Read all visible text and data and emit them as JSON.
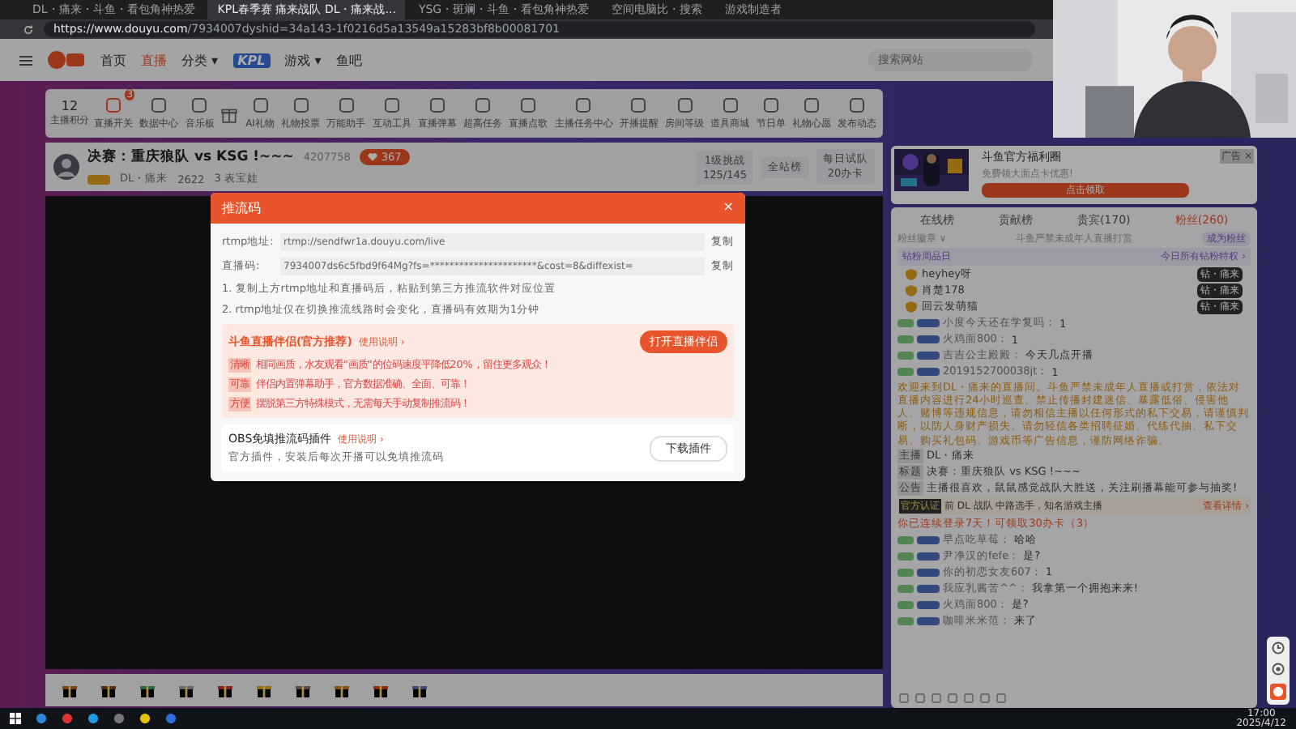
{
  "browser": {
    "tabs": [
      {
        "label": "DL・痛来・斗鱼・看包角神热爱",
        "selected": false
      },
      {
        "label": "KPL春季赛 痛来战队 DL・痛来战...",
        "selected": true
      },
      {
        "label": "YSG・斑斓・斗鱼・看包角神热爱",
        "selected": false
      },
      {
        "label": "空间电脑比・搜索",
        "selected": false
      },
      {
        "label": "游戏制造者",
        "selected": false
      }
    ],
    "url_host": "https://www.douyu.com",
    "url_path": "/7934007dyshid=34a143-1f0216d5a13549a15283bf8b00081701"
  },
  "site": {
    "nav": [
      {
        "label": "首页",
        "selected": false,
        "kind": "text"
      },
      {
        "label": "直播",
        "selected": true,
        "kind": "text"
      },
      {
        "label": "分类 ▾",
        "selected": false,
        "kind": "text"
      },
      {
        "label": "KPL",
        "selected": false,
        "kind": "logo"
      },
      {
        "label": "游戏 ▾",
        "selected": false,
        "kind": "text"
      },
      {
        "label": "鱼吧",
        "selected": false,
        "kind": "text"
      }
    ],
    "search": {
      "placeholder": "搜索网站"
    }
  },
  "toolbar": {
    "score": "12",
    "score_label": "主播积分",
    "badge": "3",
    "tools": [
      {
        "kind": "labeled",
        "label": "直播开关"
      },
      {
        "kind": "labeled",
        "label": "数据中心"
      },
      {
        "kind": "labeled",
        "label": "音乐板"
      },
      {
        "kind": "icon"
      },
      {
        "kind": "labeled",
        "label": "AI礼物"
      },
      {
        "kind": "labeled",
        "label": "礼物投票"
      },
      {
        "kind": "labeled",
        "label": "万能助手"
      },
      {
        "kind": "labeled",
        "label": "互动工具"
      },
      {
        "kind": "labeled",
        "label": "直播弹幕"
      },
      {
        "kind": "labeled",
        "label": "超高任务"
      },
      {
        "kind": "labeled",
        "label": "直播点歌"
      },
      {
        "kind": "labeled",
        "label": "主播任务中心"
      },
      {
        "kind": "labeled",
        "label": "开播提醒"
      },
      {
        "kind": "labeled",
        "label": "房间等级"
      },
      {
        "kind": "labeled",
        "label": "道具商城"
      },
      {
        "kind": "labeled",
        "label": "节日单"
      },
      {
        "kind": "labeled",
        "label": "礼物心愿"
      },
      {
        "kind": "labeled",
        "label": "发布动态"
      }
    ]
  },
  "stream": {
    "title": "决赛：重庆狼队 vs KSG !~~~",
    "room": "4207758",
    "follow": "367",
    "anchor": "DL・痛来",
    "fans": "2622",
    "extra": "3 表宝娃",
    "stats": [
      {
        "label": "1级挑战",
        "value": "125/145"
      },
      {
        "label": "全站榜"
      },
      {
        "label": "每日试队",
        "value": "20办卡"
      }
    ]
  },
  "dialog": {
    "title": "推流码",
    "close": "×",
    "fields": [
      {
        "label": "rtmp地址:",
        "value": "rtmp://sendfwr1a.douyu.com/live",
        "copy": "复制"
      },
      {
        "label": "直播码:",
        "value": "7934007ds6c5fbd9f64Mg?fs=**********************&cost=8&diffexist=",
        "copy": "复制"
      }
    ],
    "notes": [
      "1. 复制上方rtmp地址和直播码后，粘贴到第三方推流软件对应位置",
      "2. rtmp地址仅在切换推流线路时会变化，直播码有效期为1分钟"
    ],
    "promo": {
      "title": "斗鱼直播伴侣(官方推荐)",
      "help": "使用说明 ›",
      "button": "打开直播伴侣",
      "points": [
        {
          "tag": "清晰",
          "text": "相同画质，水友观看\"画质\"的位码速度平降低20%，留住更多观众！"
        },
        {
          "tag": "可靠",
          "text": "伴侣内置弹幕助手，官方数据准确、全面、可靠！"
        },
        {
          "tag": "方便",
          "text": "摆脱第三方特殊模式，无需每天手动复制推流码！"
        }
      ]
    },
    "plugin": {
      "title": "OBS免填推流码插件",
      "help": "使用说明 ›",
      "text": "官方插件，安装后每次开播可以免填推流码",
      "button": "下载插件"
    }
  },
  "ad": {
    "title": "斗鱼官方福利圈",
    "text": "免费领大面点卡优惠!",
    "button": "点击领取",
    "tag": "广告 ×"
  },
  "chat": {
    "tabs": [
      {
        "label": "在线榜",
        "selected": false
      },
      {
        "label": "贡献榜",
        "selected": false
      },
      {
        "label": "贵宾(170)",
        "selected": false
      },
      {
        "label": "粉丝(260)",
        "selected": true
      }
    ],
    "badge_select": "粉丝徽章 ∨",
    "notice": "斗鱼严禁未成年人直播打赏",
    "join": "成为粉丝",
    "fan_header": "钻粉周品日",
    "fan_link": "今日所有钻粉特权 ›",
    "fans": [
      {
        "name": "heyhey呀",
        "badge": "钻・痛来"
      },
      {
        "name": "肖楚178",
        "badge": "钻・痛来"
      },
      {
        "name": "回云发萌猫",
        "badge": "钻・痛来"
      }
    ],
    "messages": [
      {
        "kind": "msg",
        "user": "小度今天还在学复吗：",
        "text": "1"
      },
      {
        "kind": "msg",
        "user": "火鸡面800：",
        "text": "1"
      },
      {
        "kind": "msg",
        "user": "吉吉公主殿殿：",
        "text": "今天几点开播"
      },
      {
        "kind": "msg",
        "user": "2019152700038jt：",
        "text": "1"
      },
      {
        "kind": "system",
        "text": "欢迎来到DL・痛来的直播间。斗鱼严禁未成年人直播或打赏，依法对直播内容进行24小时巡查。禁止传播封建迷信、暴露低俗、侵害他人、赌博等违规信息，请勿相信主播以任何形式的私下交易，请谨慎判断，以防人身财产损失。请勿轻信各类招聘征婚、代练代抽、私下交易、购买礼包码、游戏币等广告信息，谨防网络诈骗。"
      },
      {
        "kind": "info",
        "user": "主播",
        "text": "DL・痛来"
      },
      {
        "kind": "info",
        "user": "标题",
        "text": "决赛：重庆狼队 vs KSG !~~~"
      },
      {
        "kind": "info",
        "user": "公告",
        "text": "主播很喜欢，鼠鼠感觉战队大胜送，关注刷播幕能可参与抽奖!"
      },
      {
        "kind": "cert",
        "user": "官方认证",
        "text": "前 DL 战队 中路选手，知名游戏主播",
        "link": "查看详情 ›"
      },
      {
        "kind": "login",
        "text": "你已连续登录7天！可领取30办卡（3）"
      },
      {
        "kind": "msg",
        "user": "早点吃草莓：",
        "text": "哈哈"
      },
      {
        "kind": "msg",
        "user": "尹净汉的fefe：",
        "text": "是?"
      },
      {
        "kind": "msg",
        "user": "你的初恋女友607：",
        "text": "1"
      },
      {
        "kind": "msg",
        "user": "我应乳酱苦^^：",
        "text": "我拿第一个拥抱来来!"
      },
      {
        "kind": "msg",
        "user": "火鸡面800：",
        "text": "是?"
      },
      {
        "kind": "msg",
        "user": "咖啡米米范：",
        "text": "来了"
      }
    ]
  },
  "taskbar": {
    "time": "17:00",
    "date": "2025/4/12"
  }
}
